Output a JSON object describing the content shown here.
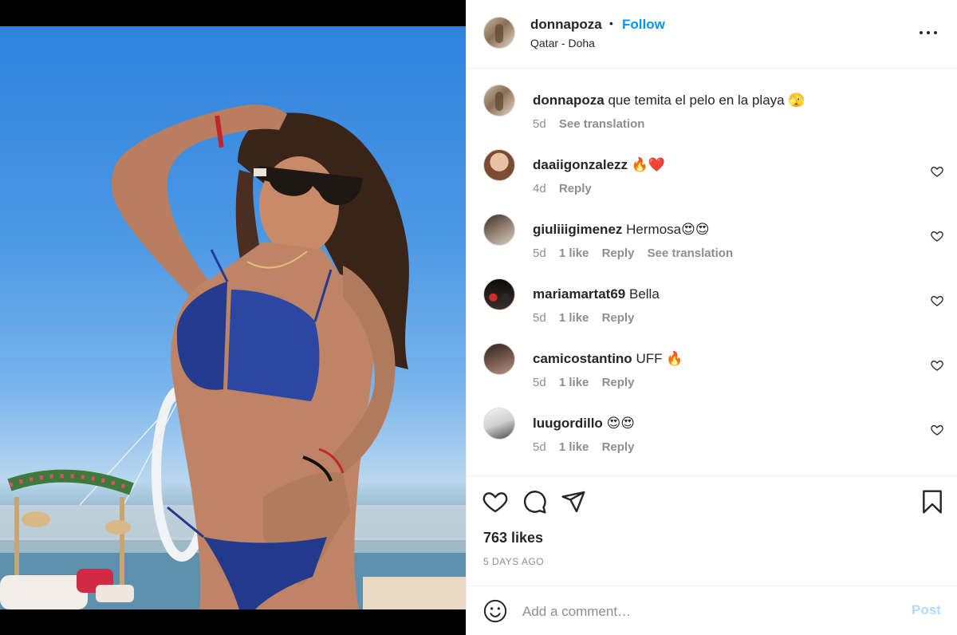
{
  "post": {
    "username": "donnapoza",
    "separator": "•",
    "follow_label": "Follow",
    "location": "Qatar - Doha",
    "more_icon": "more-horizontal-icon"
  },
  "caption": {
    "username": "donnapoza",
    "text": "que temita el pelo en la playa 🫣",
    "age": "5d",
    "see_translation": "See translation"
  },
  "comments": [
    {
      "username": "daaiigonzalezz",
      "text": "🔥❤️",
      "age": "4d",
      "likes": "",
      "reply": "Reply",
      "see_translation": ""
    },
    {
      "username": "giuliiigimenez",
      "text": "Hermosa😍😍",
      "age": "5d",
      "likes": "1 like",
      "reply": "Reply",
      "see_translation": "See translation"
    },
    {
      "username": "mariamartat69",
      "text": "Bella",
      "age": "5d",
      "likes": "1 like",
      "reply": "Reply",
      "see_translation": ""
    },
    {
      "username": "camicostantino",
      "text": "UFF 🔥",
      "age": "5d",
      "likes": "1 like",
      "reply": "Reply",
      "see_translation": ""
    },
    {
      "username": "luugordillo",
      "text": "😍😍",
      "age": "5d",
      "likes": "1 like",
      "reply": "Reply",
      "see_translation": ""
    }
  ],
  "actions": {
    "like_icon": "heart-icon",
    "comment_icon": "comment-icon",
    "share_icon": "share-icon",
    "save_icon": "bookmark-icon",
    "likes": "763 likes",
    "time_ago": "5 DAYS AGO"
  },
  "composer": {
    "emoji_icon": "emoji-icon",
    "placeholder": "Add a comment…",
    "post_label": "Post"
  },
  "colors": {
    "link_blue": "#0095f6",
    "post_disabled": "#b3dbff",
    "secondary_text": "#8e8e8e",
    "divider": "#efefef"
  }
}
